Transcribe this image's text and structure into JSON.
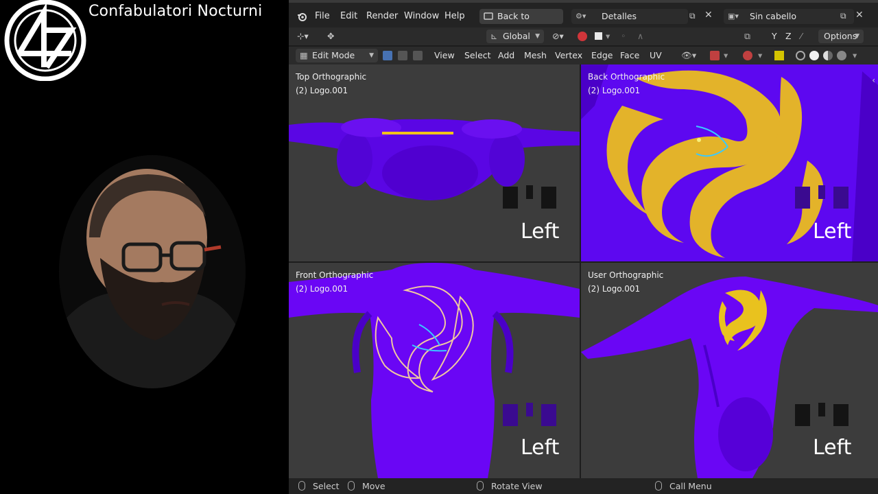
{
  "overlay": {
    "channel_name": "Confabulatori Nocturni"
  },
  "blender": {
    "menu": {
      "file": "File",
      "edit": "Edit",
      "render": "Render",
      "window": "Window",
      "help": "Help",
      "back_to_previous": "Back to Previous",
      "workspace": "Detalles",
      "scene": "Sin cabello"
    },
    "header": {
      "orientation": "Global",
      "axes": [
        "Y",
        "Z"
      ],
      "options": "Options",
      "mode": "Edit Mode",
      "view": "View",
      "select": "Select",
      "add": "Add",
      "mesh": "Mesh",
      "vertex": "Vertex",
      "edge": "Edge",
      "face": "Face",
      "uv": "UV"
    },
    "viewports": [
      {
        "name": "Top Orthographic",
        "object": "(2) Logo.001",
        "corner": "Left"
      },
      {
        "name": "Back Orthographic",
        "object": "(2) Logo.001",
        "corner": "Left"
      },
      {
        "name": "Front Orthographic",
        "object": "(2) Logo.001",
        "corner": "Left"
      },
      {
        "name": "User Orthographic",
        "object": "(2) Logo.001",
        "corner": "Left"
      }
    ],
    "status": {
      "select": "Select",
      "move": "Move",
      "rotate": "Rotate View",
      "menu": "Call Menu"
    }
  },
  "colors": {
    "mesh": "#6a06f5",
    "mesh_dark": "#4700c9",
    "viewport_bg": "#3c3c3c",
    "selection": "#f2c21a",
    "edge_active": "#39c9ff"
  }
}
